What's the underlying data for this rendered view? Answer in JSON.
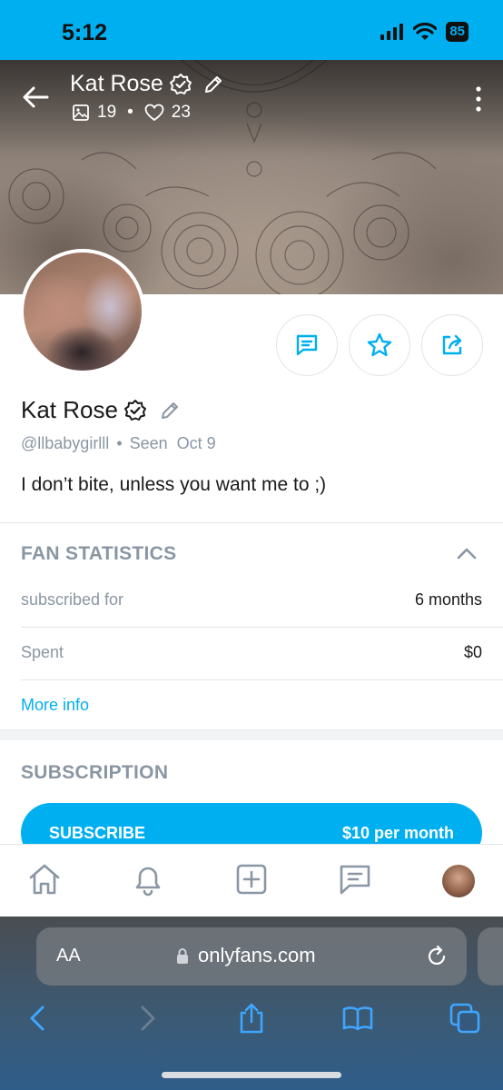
{
  "status_bar": {
    "time": "5:12",
    "battery": "85",
    "icons": [
      "signal-icon",
      "wifi-icon",
      "battery-icon"
    ]
  },
  "header": {
    "name": "Kat Rose",
    "media_count": "19",
    "likes_count": "23",
    "icons": [
      "back-arrow-icon",
      "verified-badge-icon",
      "edit-pencil-icon",
      "image-icon",
      "heart-icon",
      "more-vertical-icon"
    ]
  },
  "profile": {
    "name": "Kat Rose",
    "username": "@llbabygirlll",
    "separator": "•",
    "seen": "Seen  Oct 9",
    "bio": "I don’t bite, unless you want me to ;)"
  },
  "action_buttons": [
    "message-icon",
    "star-icon",
    "share-icon"
  ],
  "fan_statistics": {
    "title": "FAN STATISTICS",
    "rows": [
      {
        "label": "subscribed for",
        "value": "6 months"
      },
      {
        "label": "Spent",
        "value": "$0"
      }
    ],
    "more_info": "More info"
  },
  "subscription": {
    "title": "SUBSCRIPTION",
    "button_label": "SUBSCRIBE",
    "price": "$10 per month"
  },
  "bottom_nav": [
    "home-icon",
    "bell-icon",
    "add-post-icon",
    "messages-icon",
    "profile-avatar"
  ],
  "safari": {
    "text_size": "AA",
    "url": "onlyfans.com",
    "tools": [
      "back-icon",
      "forward-icon",
      "share-icon",
      "bookmarks-icon",
      "tabs-icon"
    ]
  },
  "colors": {
    "brand": "#00aff0",
    "muted": "#8a96a3",
    "text": "#1a1a1a"
  }
}
